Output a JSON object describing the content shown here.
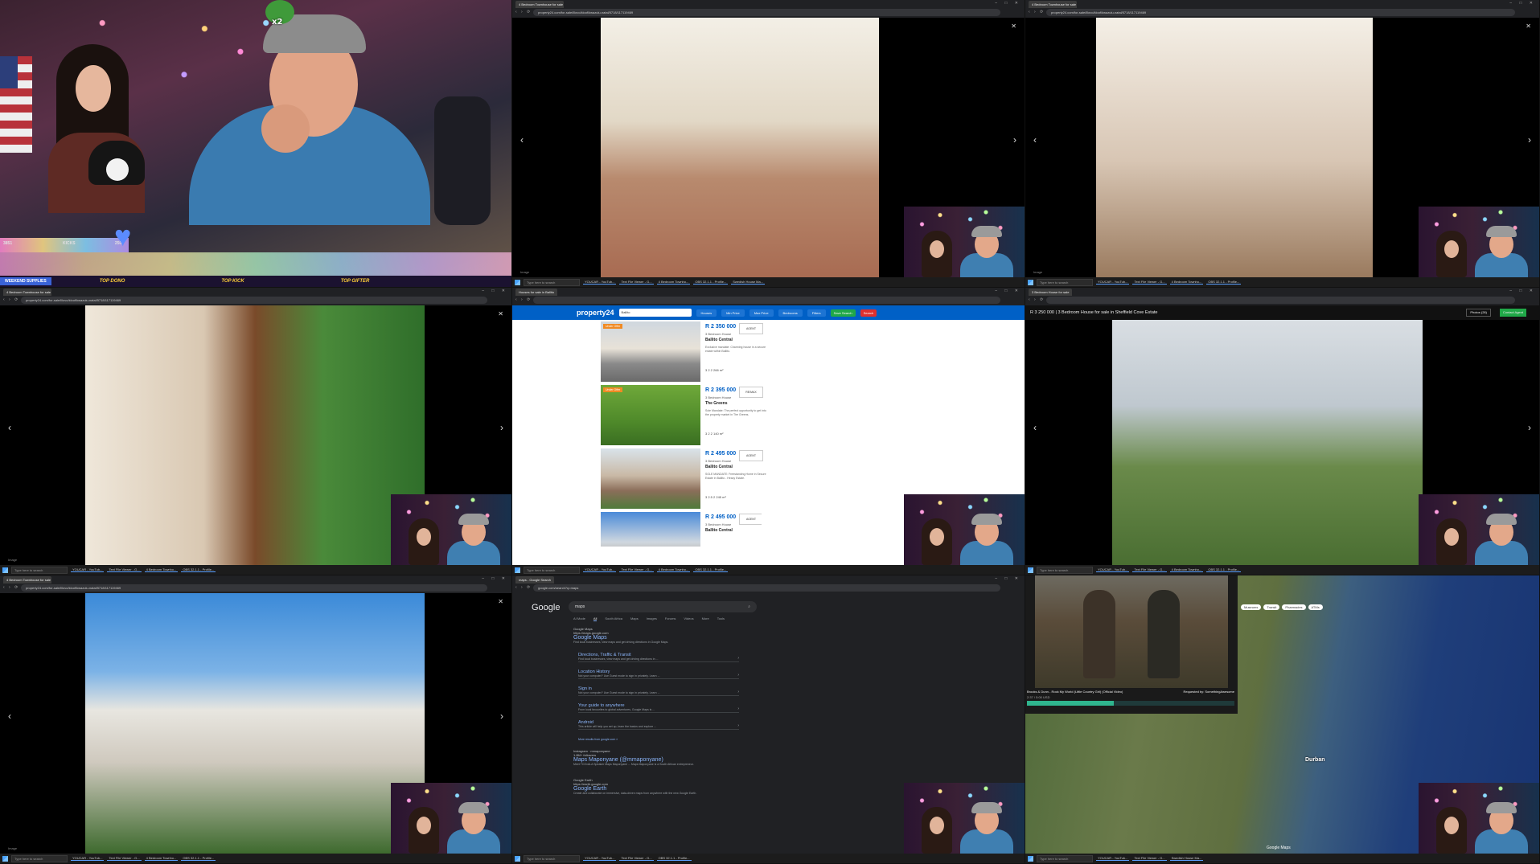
{
  "stream": {
    "frog_counter": "x2",
    "sub_bar": {
      "left": "3851",
      "label": "KICKS",
      "right": "2500"
    },
    "weekend_label": "WEEKEND SUPPLIES",
    "ticker": [
      "TOP DONO",
      "TOP KICK",
      "TOP GIFTER"
    ]
  },
  "common": {
    "taskbar_search": "Type here to search",
    "image_label": "Image",
    "apps": [
      "YOUCAR - YouTub...",
      "Text File Viewer - G...",
      "4 Bedroom Townho...",
      "OBS 32.1.1 - Profile...",
      "Swedish House Ma..."
    ]
  },
  "cells": {
    "sunroom": {
      "tab": "4 Bedroom Townhouse for sale",
      "url": "property24.com/for-sale/illovo/kloof/kwazulu-natal/5718/117119469"
    },
    "bedroom": {
      "tab": "4 Bedroom Townhouse for sale",
      "url": "property24.com/for-sale/illovo/kloof/kwazulu-natal/5718/117119469"
    },
    "doorway": {
      "tab": "4 Bedroom Townhouse for sale",
      "url": "property24.com/for-sale/illovo/kloof/kwazulu-natal/5718/117119469"
    },
    "listings": {
      "tab": "Houses for sale in Ballito",
      "logo": "property24",
      "search_chip": "Ballito",
      "filters": [
        "Houses",
        "Min Price",
        "Max Price",
        "Bedrooms",
        "Filters"
      ],
      "save_search": "Save Search",
      "search_btn": "Search",
      "items": [
        {
          "price": "R 2 350 000",
          "type": "3 Bedroom House",
          "loc": "Ballito Central",
          "desc": "Exclusive mandate: Charming house in a secure estate within Ballito.",
          "stats": "3   2   2   266 m²",
          "agent": "AGENT",
          "tag": "Under Offer"
        },
        {
          "price": "R 2 395 000",
          "type": "3 Bedroom House",
          "loc": "The Greens",
          "desc": "Sole Mandate: The perfect opportunity to get into the property market in The Greens.",
          "stats": "3   2   2   140 m²",
          "agent": "RE/MAX",
          "tag": "Under Offer"
        },
        {
          "price": "R 2 495 000",
          "type": "3 Bedroom House",
          "loc": "Ballito Central",
          "desc": "SOLE MANDATE: Freestanding Home in Secure Estate in Ballito - Heavy Estate.",
          "stats": "3   2.5   2   245 m²",
          "agent": "AGENT",
          "tag": ""
        },
        {
          "price": "R 2 495 000",
          "type": "3 Bedroom House",
          "loc": "Ballito Central",
          "desc": "",
          "stats": "",
          "agent": "AGENT",
          "tag": ""
        }
      ]
    },
    "house": {
      "tab": "3 Bedroom House for sale",
      "header": "R 3 250 000 | 3 Bedroom House for sale in Sheffield Cove Estate",
      "photos_btn": "Photos (28)",
      "contact_btn": "Contact Agent"
    },
    "gable": {
      "tab": "4 Bedroom Townhouse for sale",
      "url": "property24.com/for-sale/illovo/kloof/kwazulu-natal/5718/117119469"
    },
    "google": {
      "tab": "maps - Google Search",
      "url": "google.com/search?q=maps",
      "logo": "Google",
      "query": "maps",
      "tabs": [
        "AI Mode",
        "All",
        "South Africa",
        "Maps",
        "Images",
        "Forums",
        "Videos",
        "More",
        "Tools"
      ],
      "result": {
        "site": "Google Maps",
        "site_url": "https://maps.google.com",
        "title": "Google Maps",
        "snippet": "Find local businesses, view maps and get driving directions in Google Maps."
      },
      "subs": [
        {
          "title": "Directions, Traffic & Transit",
          "snip": "Find local businesses, view maps and get driving directions in ..."
        },
        {
          "title": "Location History",
          "snip": "Not your computer? Use Guest mode to sign in privately. Learn ..."
        },
        {
          "title": "Sign in",
          "snip": "Not your computer? Use Guest mode to sign in privately. Learn ..."
        },
        {
          "title": "Your guide to anywhere",
          "snip": "From local favourites to global adventures, Google Maps is ..."
        },
        {
          "title": "Android",
          "snip": "This article will help you set up, learn the basics and explore ..."
        }
      ],
      "more": "More results from google.com »",
      "r2": {
        "site": "Instagram · mmaponyane",
        "site_url": "1.8M+ followers",
        "title": "Maps Maponyane (@mmaponyane)",
        "snippet": "Meet TCOvALA Speaker Maps Maponyane ... Maps Maponyane is a South African entrepreneur."
      },
      "r3": {
        "site": "Google Earth",
        "site_url": "https://earth.google.com",
        "title": "Google Earth",
        "snippet": "Create and collaborate on immersive, data-driven maps from anywhere with the new Google Earth."
      }
    },
    "maps": {
      "video_title": "Brooks & Dunn - Rock My World (Little Country Girl) (Official Video)",
      "requested_by": "Requested by: SomethingAwesome",
      "time": "2:37 / 5:00 USD",
      "progress": 0.42,
      "chips": [
        "Museums",
        "Transit",
        "Pharmacies",
        "ATMs"
      ],
      "city": "Durban",
      "maps_logo": "Google Maps"
    }
  }
}
